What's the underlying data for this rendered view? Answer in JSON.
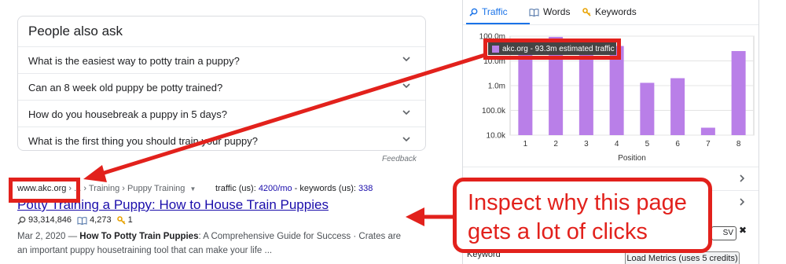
{
  "people_also_ask": {
    "title": "People also ask",
    "questions": [
      "What is the easiest way to potty train a puppy?",
      "Can an 8 week old puppy be potty trained?",
      "How do you housebreak a puppy in 5 days?",
      "What is the first thing you should train your puppy?"
    ],
    "feedback": "Feedback"
  },
  "result": {
    "domain": "www.akc.org",
    "crumbs": "› ... › Training › Puppy Training",
    "traffic_label": "traffic (us): ",
    "traffic_value": "4200/mo",
    "keywords_label": " - keywords (us): ",
    "keywords_value": "338",
    "title": "Potty Training a Puppy: How to House Train Puppies",
    "traffic_count": "93,314,846",
    "words_count": "4,273",
    "keywords_count": "1",
    "date": "Mar 2, 2020 — ",
    "snippet_bold": "How To Potty Train Puppies",
    "snippet_rest": ": A Comprehensive Guide for Success · Crates are",
    "snippet_line2": "an important puppy housetraining tool that can make your life ..."
  },
  "panel": {
    "tabs": [
      "Traffic",
      "Words",
      "Keywords"
    ],
    "tooltip": "akc.org - 93.3m estimated traffic",
    "csv_label": "SV",
    "close_glyph": "✖",
    "keyword_label": "Keyword",
    "load_button": "Load Metrics (uses 5 credits)"
  },
  "chart_data": {
    "type": "bar",
    "y_scale": "log",
    "ylim": [
      10000,
      100000000
    ],
    "ytick_labels": [
      "100.0m",
      "10.0m",
      "1.0m",
      "100.0k",
      "10.0k"
    ],
    "categories": [
      "1",
      "2",
      "3",
      "4",
      "5",
      "6",
      "7",
      "8"
    ],
    "values": [
      30000000,
      93300000,
      50000000,
      40000000,
      1300000,
      2000000,
      20000,
      25000000
    ],
    "xlabel": "Position",
    "ylabel": "",
    "bar_color": "#b97fe8",
    "grid": true
  },
  "annotation": {
    "callout_line1": "Inspect why this page",
    "callout_line2": "gets a lot of clicks",
    "color": "#e2211c"
  }
}
